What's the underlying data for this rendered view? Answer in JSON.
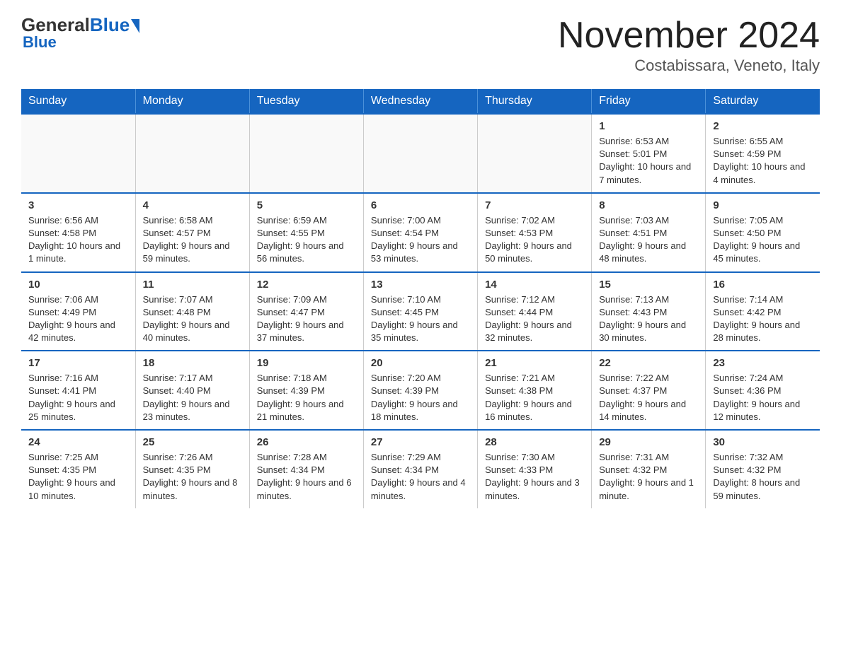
{
  "header": {
    "logo_general": "General",
    "logo_blue": "Blue",
    "month_title": "November 2024",
    "location": "Costabissara, Veneto, Italy"
  },
  "days_of_week": [
    "Sunday",
    "Monday",
    "Tuesday",
    "Wednesday",
    "Thursday",
    "Friday",
    "Saturday"
  ],
  "weeks": [
    [
      {
        "day": "",
        "info": ""
      },
      {
        "day": "",
        "info": ""
      },
      {
        "day": "",
        "info": ""
      },
      {
        "day": "",
        "info": ""
      },
      {
        "day": "",
        "info": ""
      },
      {
        "day": "1",
        "info": "Sunrise: 6:53 AM\nSunset: 5:01 PM\nDaylight: 10 hours and 7 minutes."
      },
      {
        "day": "2",
        "info": "Sunrise: 6:55 AM\nSunset: 4:59 PM\nDaylight: 10 hours and 4 minutes."
      }
    ],
    [
      {
        "day": "3",
        "info": "Sunrise: 6:56 AM\nSunset: 4:58 PM\nDaylight: 10 hours and 1 minute."
      },
      {
        "day": "4",
        "info": "Sunrise: 6:58 AM\nSunset: 4:57 PM\nDaylight: 9 hours and 59 minutes."
      },
      {
        "day": "5",
        "info": "Sunrise: 6:59 AM\nSunset: 4:55 PM\nDaylight: 9 hours and 56 minutes."
      },
      {
        "day": "6",
        "info": "Sunrise: 7:00 AM\nSunset: 4:54 PM\nDaylight: 9 hours and 53 minutes."
      },
      {
        "day": "7",
        "info": "Sunrise: 7:02 AM\nSunset: 4:53 PM\nDaylight: 9 hours and 50 minutes."
      },
      {
        "day": "8",
        "info": "Sunrise: 7:03 AM\nSunset: 4:51 PM\nDaylight: 9 hours and 48 minutes."
      },
      {
        "day": "9",
        "info": "Sunrise: 7:05 AM\nSunset: 4:50 PM\nDaylight: 9 hours and 45 minutes."
      }
    ],
    [
      {
        "day": "10",
        "info": "Sunrise: 7:06 AM\nSunset: 4:49 PM\nDaylight: 9 hours and 42 minutes."
      },
      {
        "day": "11",
        "info": "Sunrise: 7:07 AM\nSunset: 4:48 PM\nDaylight: 9 hours and 40 minutes."
      },
      {
        "day": "12",
        "info": "Sunrise: 7:09 AM\nSunset: 4:47 PM\nDaylight: 9 hours and 37 minutes."
      },
      {
        "day": "13",
        "info": "Sunrise: 7:10 AM\nSunset: 4:45 PM\nDaylight: 9 hours and 35 minutes."
      },
      {
        "day": "14",
        "info": "Sunrise: 7:12 AM\nSunset: 4:44 PM\nDaylight: 9 hours and 32 minutes."
      },
      {
        "day": "15",
        "info": "Sunrise: 7:13 AM\nSunset: 4:43 PM\nDaylight: 9 hours and 30 minutes."
      },
      {
        "day": "16",
        "info": "Sunrise: 7:14 AM\nSunset: 4:42 PM\nDaylight: 9 hours and 28 minutes."
      }
    ],
    [
      {
        "day": "17",
        "info": "Sunrise: 7:16 AM\nSunset: 4:41 PM\nDaylight: 9 hours and 25 minutes."
      },
      {
        "day": "18",
        "info": "Sunrise: 7:17 AM\nSunset: 4:40 PM\nDaylight: 9 hours and 23 minutes."
      },
      {
        "day": "19",
        "info": "Sunrise: 7:18 AM\nSunset: 4:39 PM\nDaylight: 9 hours and 21 minutes."
      },
      {
        "day": "20",
        "info": "Sunrise: 7:20 AM\nSunset: 4:39 PM\nDaylight: 9 hours and 18 minutes."
      },
      {
        "day": "21",
        "info": "Sunrise: 7:21 AM\nSunset: 4:38 PM\nDaylight: 9 hours and 16 minutes."
      },
      {
        "day": "22",
        "info": "Sunrise: 7:22 AM\nSunset: 4:37 PM\nDaylight: 9 hours and 14 minutes."
      },
      {
        "day": "23",
        "info": "Sunrise: 7:24 AM\nSunset: 4:36 PM\nDaylight: 9 hours and 12 minutes."
      }
    ],
    [
      {
        "day": "24",
        "info": "Sunrise: 7:25 AM\nSunset: 4:35 PM\nDaylight: 9 hours and 10 minutes."
      },
      {
        "day": "25",
        "info": "Sunrise: 7:26 AM\nSunset: 4:35 PM\nDaylight: 9 hours and 8 minutes."
      },
      {
        "day": "26",
        "info": "Sunrise: 7:28 AM\nSunset: 4:34 PM\nDaylight: 9 hours and 6 minutes."
      },
      {
        "day": "27",
        "info": "Sunrise: 7:29 AM\nSunset: 4:34 PM\nDaylight: 9 hours and 4 minutes."
      },
      {
        "day": "28",
        "info": "Sunrise: 7:30 AM\nSunset: 4:33 PM\nDaylight: 9 hours and 3 minutes."
      },
      {
        "day": "29",
        "info": "Sunrise: 7:31 AM\nSunset: 4:32 PM\nDaylight: 9 hours and 1 minute."
      },
      {
        "day": "30",
        "info": "Sunrise: 7:32 AM\nSunset: 4:32 PM\nDaylight: 8 hours and 59 minutes."
      }
    ]
  ]
}
